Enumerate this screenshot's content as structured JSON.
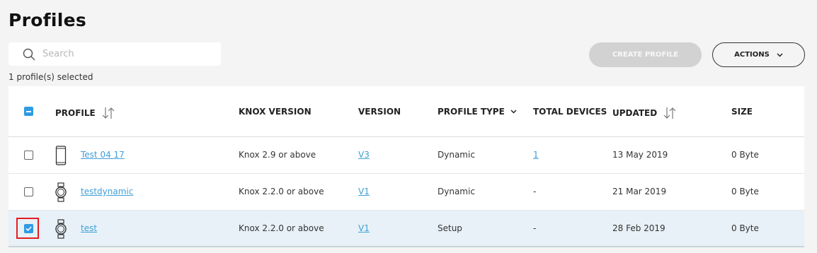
{
  "page": {
    "title": "Profiles"
  },
  "search": {
    "placeholder": "Search",
    "value": ""
  },
  "selection_text": "1 profile(s) selected",
  "buttons": {
    "create": "CREATE PROFILE",
    "actions": "ACTIONS"
  },
  "table": {
    "headers": {
      "profile": "PROFILE",
      "knox": "KNOX VERSION",
      "version": "VERSION",
      "type": "PROFILE TYPE",
      "devices": "TOTAL DEVICES",
      "updated": "UPDATED",
      "size": "SIZE"
    },
    "rows": [
      {
        "device": "phone-icon",
        "name": "Test 04 17",
        "knox": "Knox 2.9 or above",
        "version": "V3",
        "type": "Dynamic",
        "devices": "1",
        "updated": "13 May 2019",
        "size": "0 Byte",
        "checked": false
      },
      {
        "device": "watch-icon",
        "name": "testdynamic",
        "knox": "Knox 2.2.0 or above",
        "version": "V1",
        "type": "Dynamic",
        "devices": "-",
        "updated": "21 Mar 2019",
        "size": "0 Byte",
        "checked": false
      },
      {
        "device": "watch-icon",
        "name": "test",
        "knox": "Knox 2.2.0 or above",
        "version": "V1",
        "type": "Setup",
        "devices": "-",
        "updated": "28 Feb 2019",
        "size": "0 Byte",
        "checked": true
      }
    ]
  },
  "colors": {
    "link": "#3f9fd8",
    "checkbox": "#2f9be3",
    "selected_row": "#e7f1f7",
    "highlight": "#e51c23"
  }
}
